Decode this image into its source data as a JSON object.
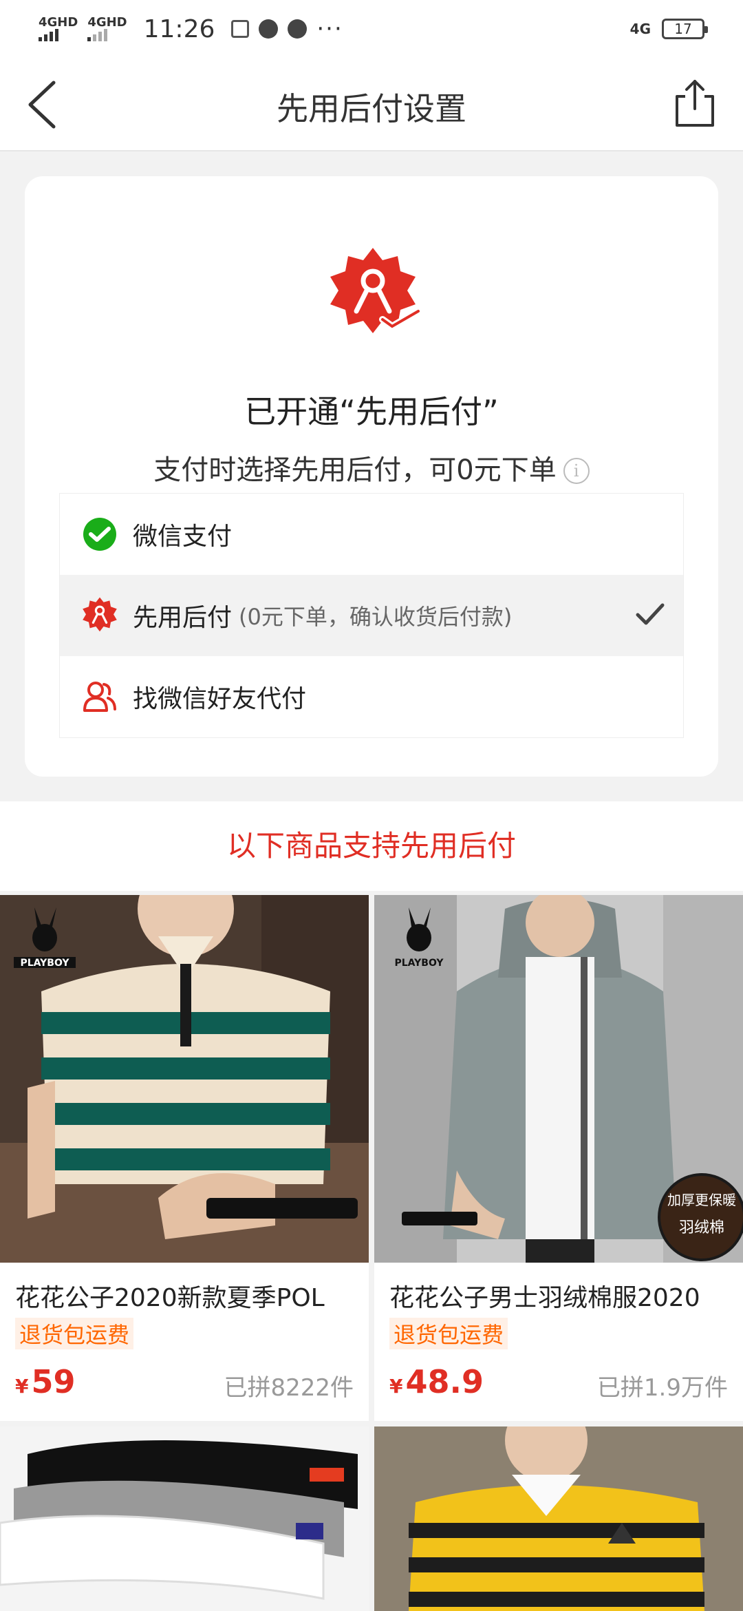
{
  "status_bar": {
    "sig1": "4GHD",
    "sig2": "4GHD",
    "time": "11:26",
    "dots": "···",
    "network": "4G",
    "battery": "17"
  },
  "nav": {
    "title": "先用后付设置"
  },
  "card": {
    "status_title": "已开通“先用后付”",
    "subtitle": "支付时选择先用后付，可0元下单",
    "options": [
      {
        "label": "微信支付",
        "note": ""
      },
      {
        "label": "先用后付",
        "note": "(0元下单，确认收货后付款)"
      },
      {
        "label": "找微信好友代付",
        "note": ""
      }
    ]
  },
  "section_heading": "以下商品支持先用后付",
  "products": [
    {
      "name": "花花公子2020新款夏季POL",
      "tag": "退货包运费",
      "currency": "¥",
      "price": "59",
      "sold": "已拼8222件",
      "logo": "PLAYBOY"
    },
    {
      "name": "花花公子男士羽绒棉服2020",
      "tag": "退货包运费",
      "currency": "¥",
      "price": "48.9",
      "sold": "已拼1.9万件",
      "logo": "PLAYBOY",
      "sticker_top": "加厚更保暖",
      "sticker_bottom": "羽绒棉"
    }
  ],
  "colors": {
    "accent": "#e02e24",
    "tag": "#ff6600",
    "wechat": "#1aad19"
  }
}
